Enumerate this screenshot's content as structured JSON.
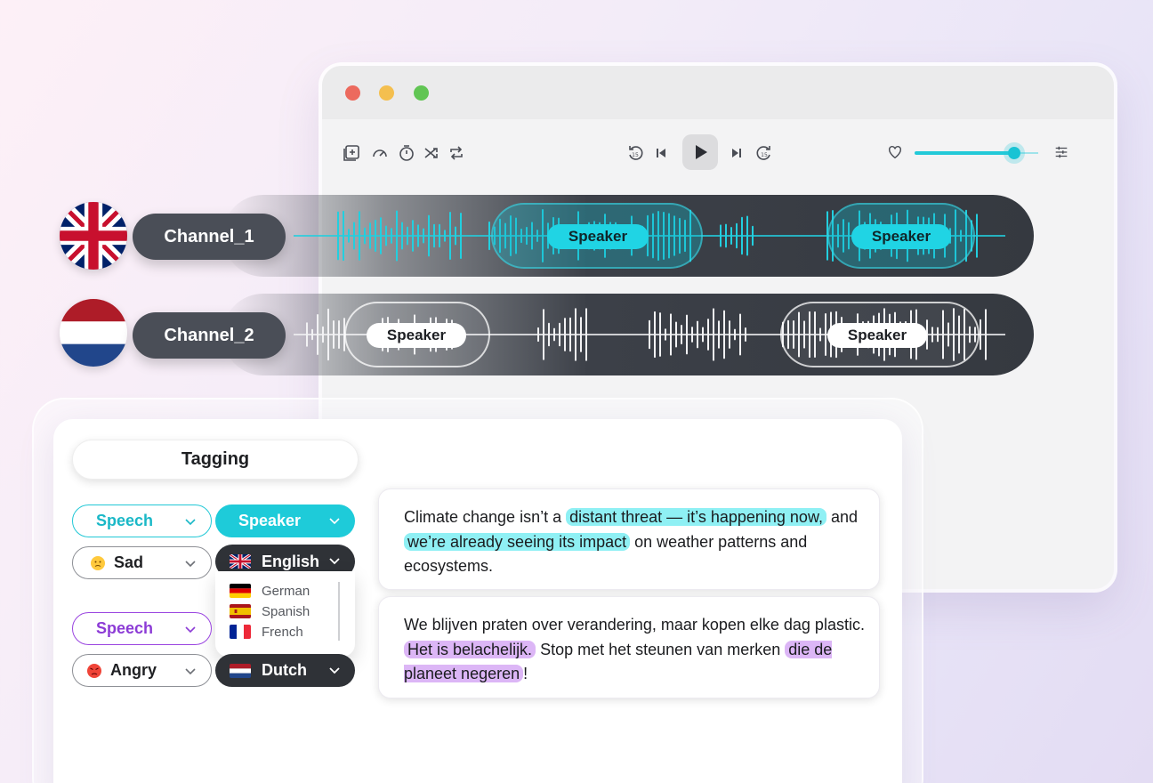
{
  "player": {
    "tools_left": [
      "add-track-icon",
      "speed-icon",
      "timer-icon",
      "shuffle-icon",
      "repeat-icon"
    ],
    "transport": [
      "rewind-15-icon",
      "skip-back-icon",
      "play-icon",
      "skip-forward-icon",
      "forward-15-icon"
    ],
    "volume_level": 0.8,
    "accent_color": "#1ecbd9"
  },
  "channels": [
    {
      "label": "Channel_1",
      "flag": "united-kingdom",
      "speakers": [
        "Speaker",
        "Speaker"
      ]
    },
    {
      "label": "Channel_2",
      "flag": "netherlands",
      "speakers": [
        "Speaker",
        "Speaker"
      ]
    }
  ],
  "tagging": {
    "title": "Tagging",
    "row1": {
      "type": "Speech",
      "role": "Speaker",
      "emotion": "Sad",
      "language": "English",
      "language_options": [
        "German",
        "Spanish",
        "French"
      ]
    },
    "row2": {
      "type": "Speech",
      "emotion": "Angry",
      "language": "Dutch"
    }
  },
  "transcripts": [
    {
      "parts": [
        "Climate change isn’t a ",
        "distant threat — it’s happening now,",
        " and ",
        "we’re already seeing its impact",
        " on weather patterns and ecosystems."
      ]
    },
    {
      "parts": [
        "We blijven praten over verandering, maar kopen elke dag plastic.",
        " Het is belachelijk.",
        " Stop met het steunen van merken ",
        "die de planeet negeren",
        "!"
      ]
    }
  ]
}
